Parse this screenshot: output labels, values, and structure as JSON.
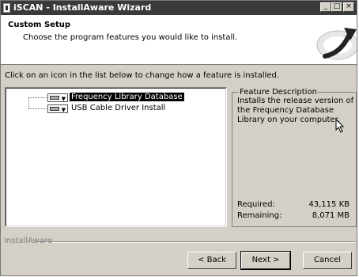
{
  "window": {
    "title": "iSCAN - InstallAware Wizard",
    "controls": {
      "minimize": "_",
      "maximize": "□",
      "close": "×"
    }
  },
  "header": {
    "title": "Custom Setup",
    "subtitle": "Choose the program features you would like to install."
  },
  "instruction": "Click on an icon in the list below to change how a feature is installed.",
  "features": [
    {
      "label": "Frequency Library Database",
      "selected": true,
      "icon": "drive-dropdown-icon"
    },
    {
      "label": "USB Cable Driver Install",
      "selected": false,
      "icon": "drive-dropdown-icon"
    }
  ],
  "description": {
    "legend": "Feature Description",
    "text": "Installs the release version of the Frequency Database Library on your computer.",
    "required_label": "Required:",
    "required_value": "43,115 KB",
    "remaining_label": "Remaining:",
    "remaining_value": "8,071 MB"
  },
  "footer": {
    "brand": "InstallAware",
    "back": "< Back",
    "next": "Next >",
    "cancel": "Cancel"
  }
}
